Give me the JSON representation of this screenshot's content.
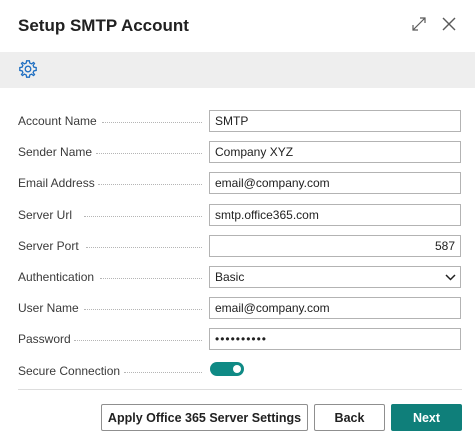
{
  "dialog": {
    "title": "Setup SMTP Account",
    "expand_icon": "expand-icon",
    "close_icon": "close-icon"
  },
  "toolbar": {
    "settings_icon": "gear-icon"
  },
  "form": {
    "account_name": {
      "label": "Account Name",
      "value": "SMTP"
    },
    "sender_name": {
      "label": "Sender Name",
      "value": "Company XYZ"
    },
    "email_address": {
      "label": "Email Address",
      "value": "email@company.com"
    },
    "server_url": {
      "label": "Server Url",
      "value": "smtp.office365.com"
    },
    "server_port": {
      "label": "Server Port",
      "value": "587"
    },
    "authentication": {
      "label": "Authentication",
      "value": "Basic"
    },
    "user_name": {
      "label": "User Name",
      "value": "email@company.com"
    },
    "password": {
      "label": "Password",
      "value": "••••••••••"
    },
    "secure_connection": {
      "label": "Secure Connection",
      "on": true
    }
  },
  "footer": {
    "apply_label": "Apply Office 365 Server Settings",
    "back_label": "Back",
    "next_label": "Next"
  },
  "colors": {
    "accent": "#0f7f7a",
    "toolbar_bg": "#eeeeee",
    "border": "#b3b3b3"
  }
}
